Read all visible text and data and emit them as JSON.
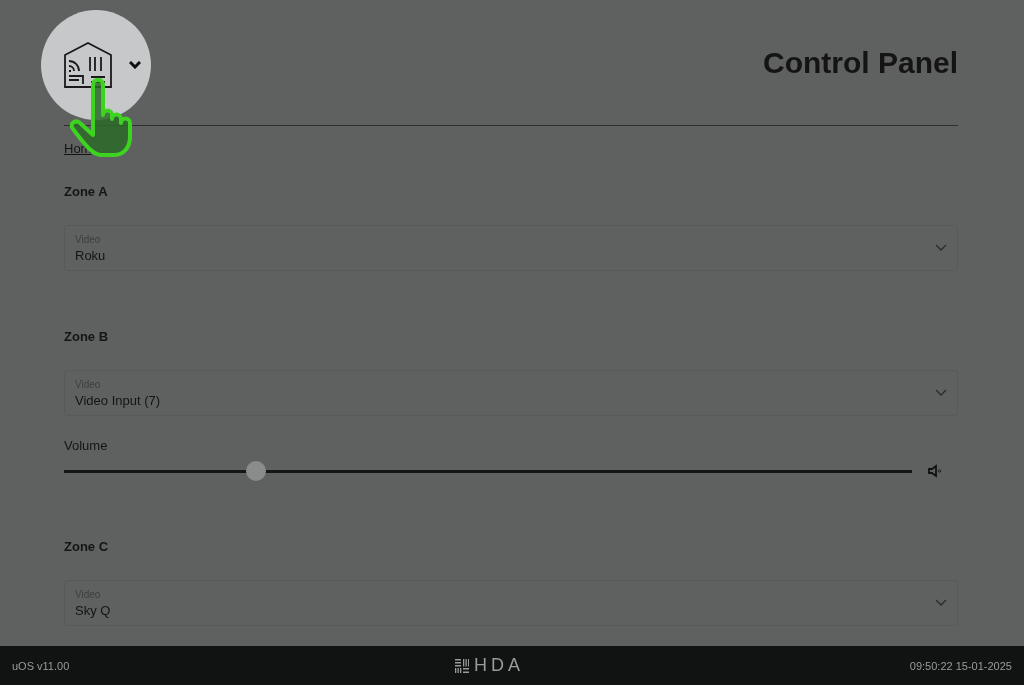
{
  "header": {
    "title": "Control Panel"
  },
  "breadcrumb": {
    "label": "Hom"
  },
  "zones": [
    {
      "name": "Zone A",
      "select": {
        "label": "Video",
        "value": "Roku"
      }
    },
    {
      "name": "Zone B",
      "select": {
        "label": "Video",
        "value": "Video Input (7)"
      },
      "volume": {
        "label": "Volume",
        "level": 0.226
      }
    },
    {
      "name": "Zone C",
      "select": {
        "label": "Video",
        "value": "Sky Q"
      }
    }
  ],
  "footer": {
    "version": "uOS v11.00",
    "brand": "HDA",
    "datetime": "09:50:22 15-01-2025"
  }
}
